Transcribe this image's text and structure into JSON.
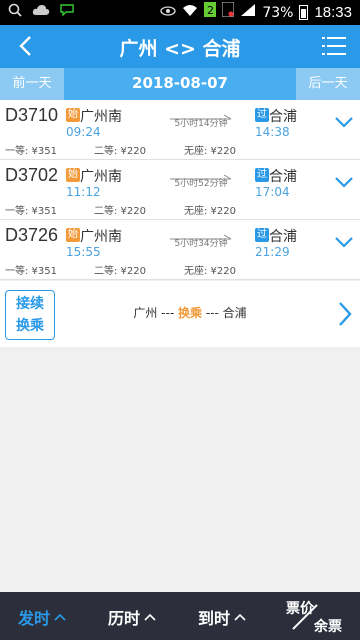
{
  "status_bar": {
    "battery": "73%",
    "time": "18:33"
  },
  "header": {
    "back_icon": "chevron-left-icon",
    "title": "广州 <> 合浦",
    "menu_icon": "list-menu-icon"
  },
  "date_bar": {
    "prev": "前一天",
    "date": "2018-08-07",
    "next": "后一天"
  },
  "trains": [
    {
      "no": "D3710",
      "from_badge": "始",
      "from": "广州南",
      "dep": "09:24",
      "duration": "5小时14分钟",
      "to_badge": "过",
      "to": "合浦",
      "arr": "14:38",
      "p1": "一等: ¥351",
      "p2": "二等: ¥220",
      "p3": "无座: ¥220"
    },
    {
      "no": "D3702",
      "from_badge": "始",
      "from": "广州南",
      "dep": "11:12",
      "duration": "5小时52分钟",
      "to_badge": "过",
      "to": "合浦",
      "arr": "17:04",
      "p1": "一等: ¥351",
      "p2": "二等: ¥220",
      "p3": "无座: ¥220"
    },
    {
      "no": "D3726",
      "from_badge": "始",
      "from": "广州南",
      "dep": "15:55",
      "duration": "5小时34分钟",
      "to_badge": "过",
      "to": "合浦",
      "arr": "21:29",
      "p1": "一等: ¥351",
      "p2": "二等: ¥220",
      "p3": "无座: ¥220"
    }
  ],
  "transfer": {
    "button_line1": "接续",
    "button_line2": "换乘",
    "from": "广州",
    "sep1": " --- ",
    "via": "换乘",
    "sep2": " --- ",
    "to": "合浦"
  },
  "bottom_bar": {
    "sort_depart": "发时",
    "sort_duration": "历时",
    "sort_arrive": "到时",
    "sort_price": "票价",
    "sort_remain": "余票"
  },
  "colors": {
    "accent": "#2a9ae8",
    "start_badge": "#f39a3b",
    "time_text": "#4aa3e0",
    "bottom_bg": "#2c2f3b"
  }
}
